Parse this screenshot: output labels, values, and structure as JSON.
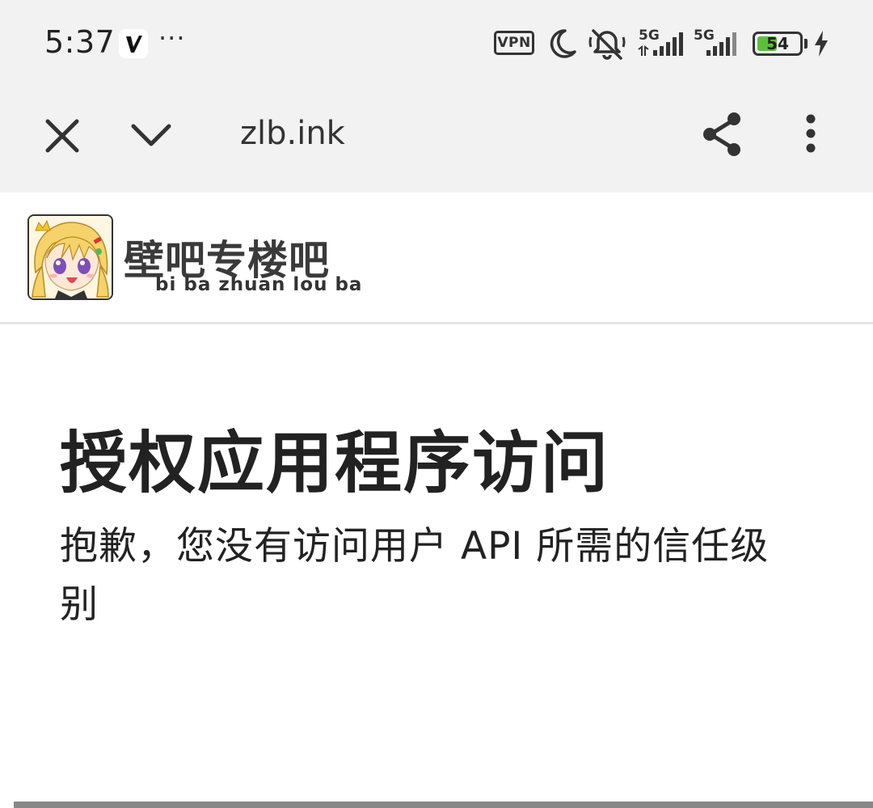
{
  "status_bar": {
    "time": "5:37",
    "more": "···",
    "vpn": "VPN",
    "network1": "5G",
    "network2": "5G",
    "battery_level": "54",
    "battery_fraction": 0.54,
    "battery_color": "#5bbf3c",
    "icons": [
      "app-v-icon",
      "moon-icon",
      "mute-icon",
      "signal-icon",
      "charging-icon"
    ]
  },
  "toolbar": {
    "url": "zlb.ink",
    "icons": [
      "close-icon",
      "chevron-down-icon",
      "share-icon",
      "more-vert-icon"
    ]
  },
  "site": {
    "title": "壁吧专楼吧",
    "subtitle": "bi ba zhuan lou ba"
  },
  "main": {
    "heading": "授权应用程序访问",
    "message": "抱歉，您没有访问用户 API 所需的信任级别"
  }
}
